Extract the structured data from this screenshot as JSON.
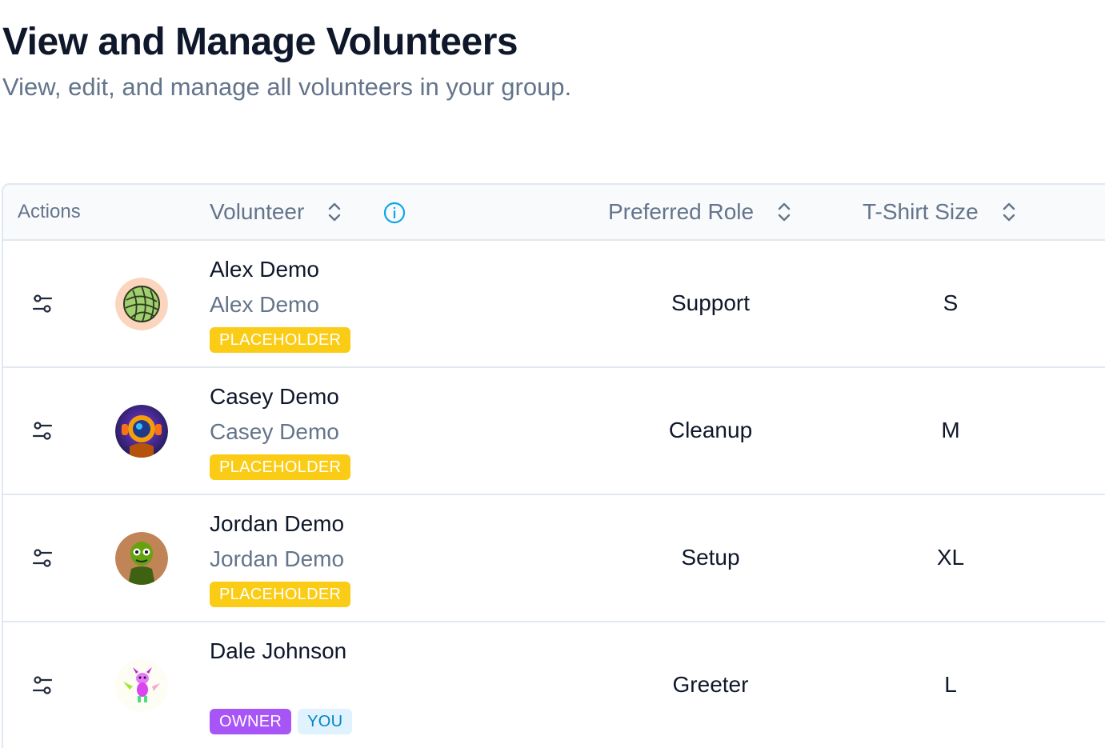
{
  "header": {
    "title": "View and Manage Volunteers",
    "subtitle": "View, edit, and manage all volunteers in your group."
  },
  "table": {
    "columns": {
      "actions": "Actions",
      "volunteer": "Volunteer",
      "preferred_role": "Preferred Role",
      "tshirt_size": "T-Shirt Size"
    },
    "rows": [
      {
        "name": "Alex Demo",
        "display_name": "Alex Demo",
        "badges": [
          "PLACEHOLDER"
        ],
        "preferred_role": "Support",
        "tshirt_size": "S",
        "avatar": "ball-of-yarn-avatar"
      },
      {
        "name": "Casey Demo",
        "display_name": "Casey Demo",
        "badges": [
          "PLACEHOLDER"
        ],
        "preferred_role": "Cleanup",
        "tshirt_size": "M",
        "avatar": "robot-avatar"
      },
      {
        "name": "Jordan Demo",
        "display_name": "Jordan Demo",
        "badges": [
          "PLACEHOLDER"
        ],
        "preferred_role": "Setup",
        "tshirt_size": "XL",
        "avatar": "zombie-avatar"
      },
      {
        "name": "Dale Johnson",
        "display_name": "",
        "badges": [
          "OWNER",
          "YOU"
        ],
        "preferred_role": "Greeter",
        "tshirt_size": "L",
        "avatar": "dragon-avatar"
      }
    ]
  },
  "colors": {
    "placeholder_badge": "#facc15",
    "owner_badge": "#a855f7",
    "you_badge_bg": "#e0f2fe",
    "you_badge_text": "#0284c7",
    "info_icon": "#0ea5e9"
  }
}
